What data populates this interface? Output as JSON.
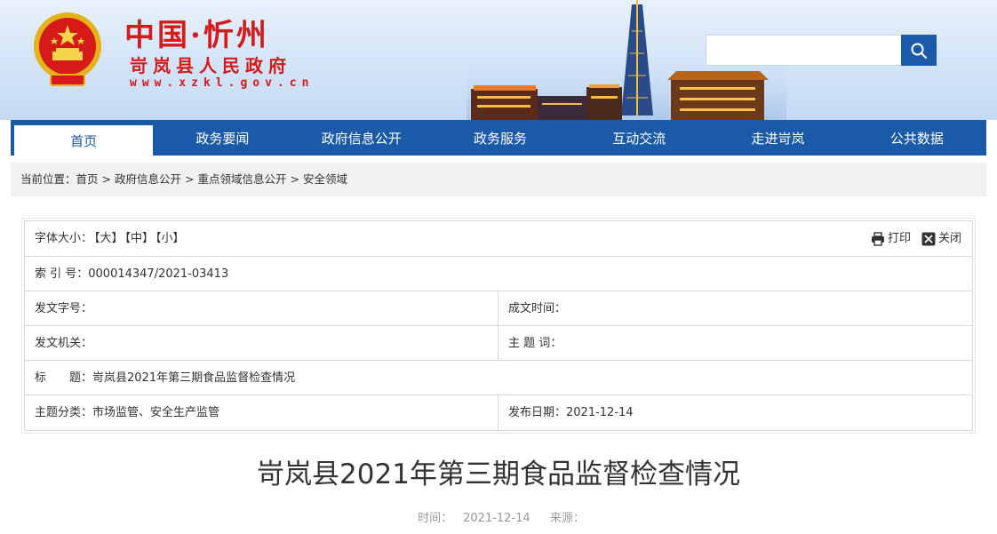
{
  "header": {
    "logo_main": "中国·忻州",
    "logo_sub": "岢岚县人民政府",
    "logo_url": "www.xzkl.gov.cn",
    "search_placeholder": ""
  },
  "nav": {
    "items": [
      {
        "label": "首页"
      },
      {
        "label": "政务要闻"
      },
      {
        "label": "政府信息公开"
      },
      {
        "label": "政务服务"
      },
      {
        "label": "互动交流"
      },
      {
        "label": "走进岢岚"
      },
      {
        "label": "公共数据"
      }
    ]
  },
  "breadcrumb": {
    "prefix": "当前位置：",
    "items": [
      "首页",
      "政府信息公开",
      "重点领域信息公开",
      "安全领域"
    ],
    "sep": ">"
  },
  "info": {
    "font_size_label": "字体大小：",
    "font_large": "【大】",
    "font_medium": "【中】",
    "font_small": "【小】",
    "print_label": "打印",
    "close_label": "关闭",
    "index_label": "索 引 号：",
    "index_value": "000014347/2021-03413",
    "doc_no_label": "发文字号：",
    "doc_no_value": "",
    "date_written_label": "成文时间：",
    "date_written_value": "",
    "issuer_label": "发文机关：",
    "issuer_value": "",
    "keywords_label": "主 题 词：",
    "keywords_value": "",
    "title_label": "标　　题：",
    "title_value": "岢岚县2021年第三期食品监督检查情况",
    "category_label": "主题分类：",
    "category_value": "市场监管、安全生产监管",
    "publish_label": "发布日期：",
    "publish_value": "2021-12-14"
  },
  "article": {
    "title": "岢岚县2021年第三期食品监督检查情况",
    "time_label": "时间：",
    "time_value": "2021-12-14",
    "source_label": "来源："
  },
  "colors": {
    "brand_blue": "#1a5aa8",
    "logo_red": "#d61a1a"
  }
}
